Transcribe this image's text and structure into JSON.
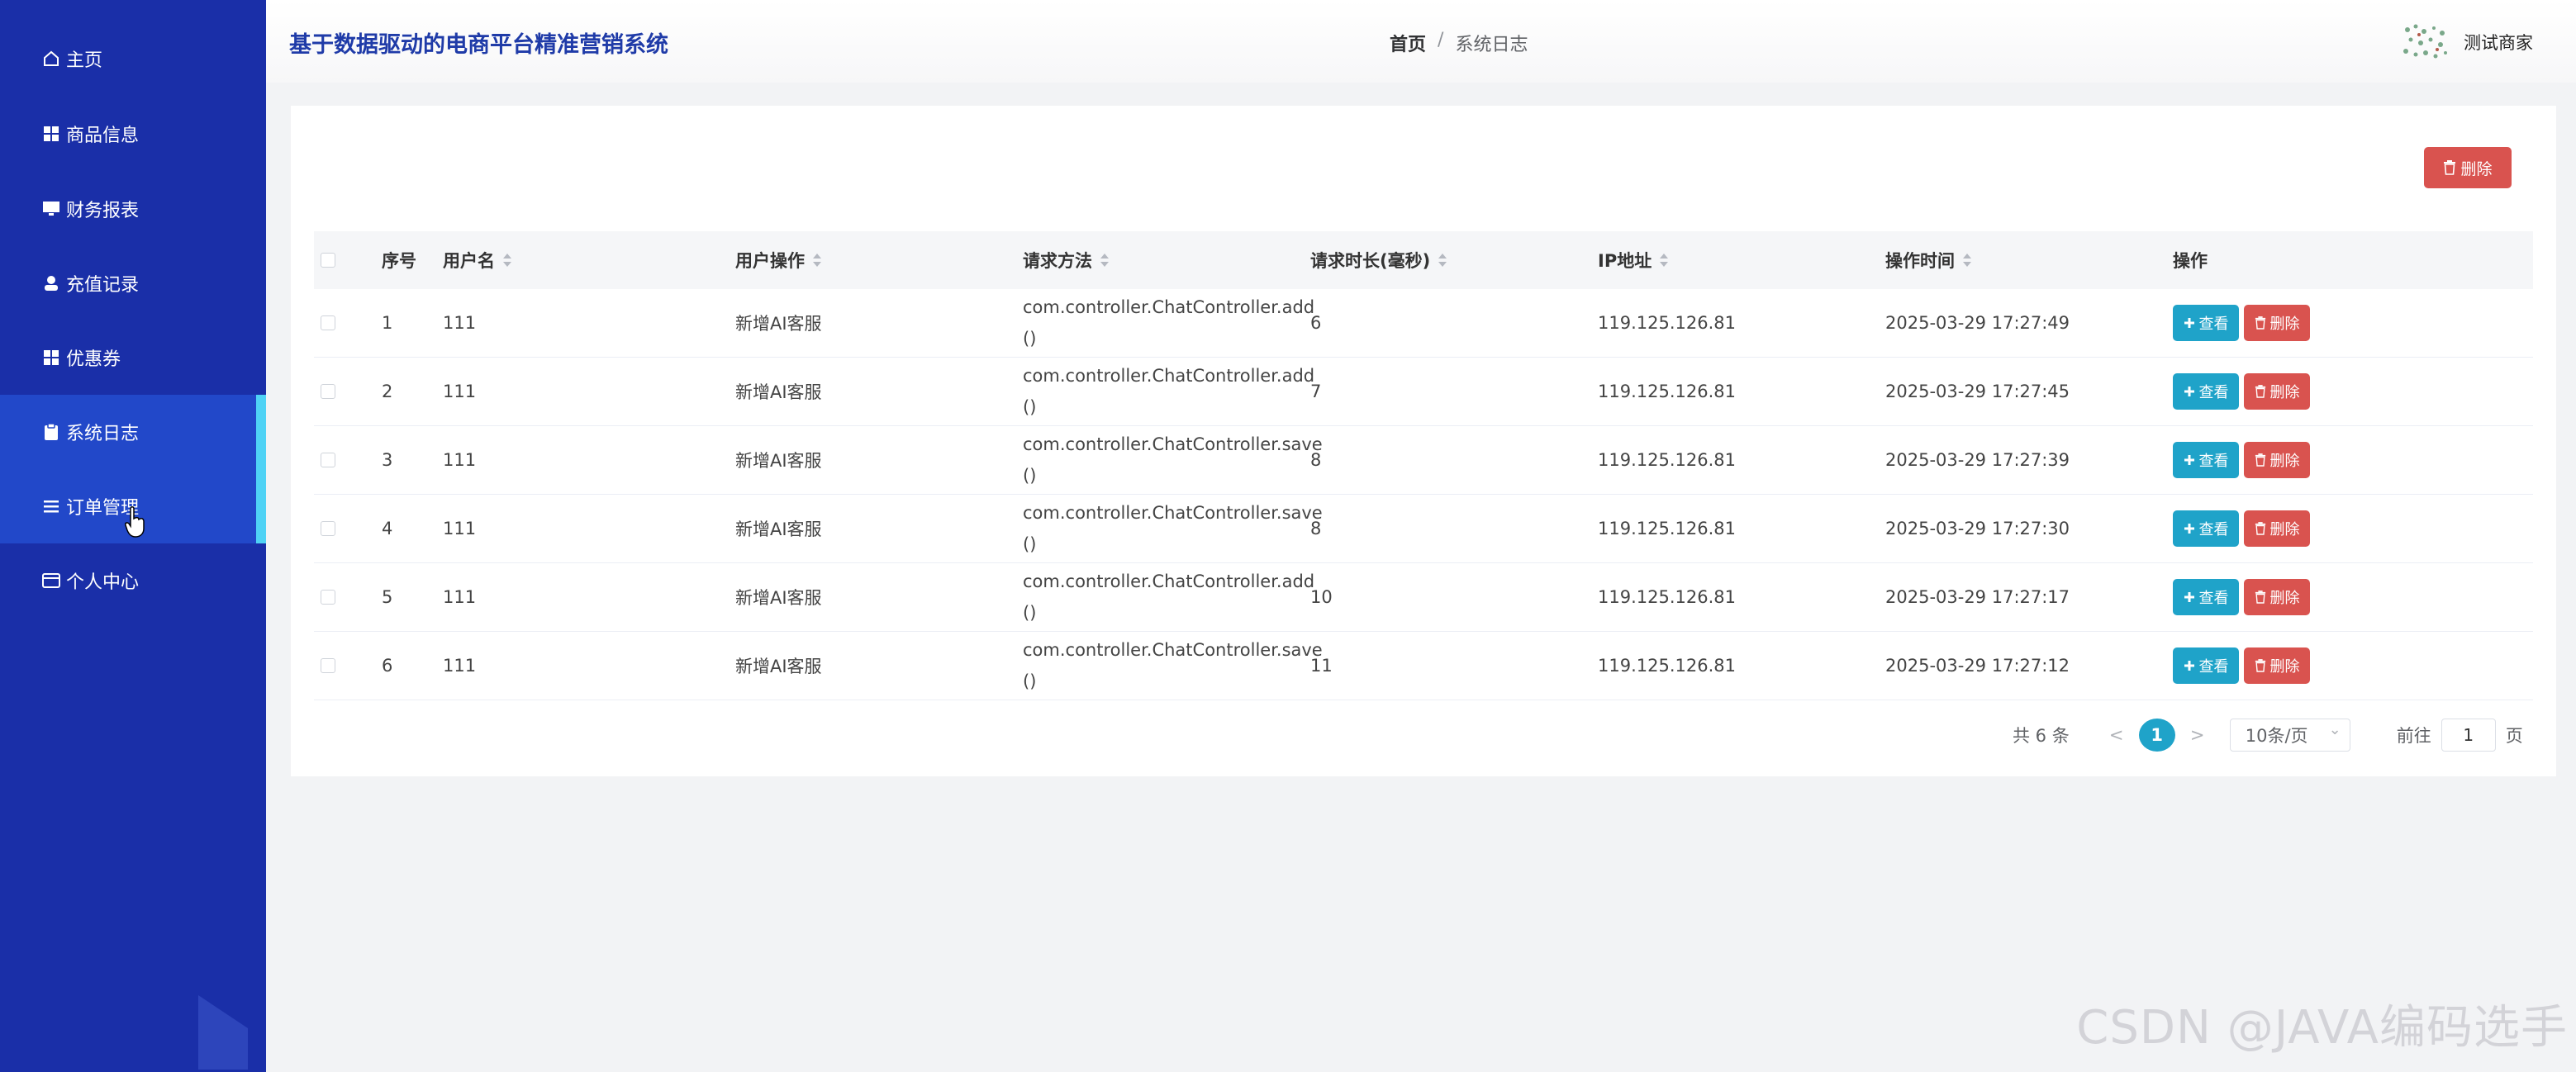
{
  "app_title": "基于数据驱动的电商平台精准营销系统",
  "breadcrumb": {
    "home": "首页",
    "separator": "/",
    "current": "系统日志"
  },
  "user": {
    "name": "测试商家"
  },
  "sidebar": {
    "items": [
      {
        "label": "主页",
        "icon": "home-icon"
      },
      {
        "label": "商品信息",
        "icon": "grid-icon"
      },
      {
        "label": "财务报表",
        "icon": "monitor-icon"
      },
      {
        "label": "充值记录",
        "icon": "user-icon"
      },
      {
        "label": "优惠券",
        "icon": "grid-icon"
      },
      {
        "label": "系统日志",
        "icon": "clipboard-icon"
      },
      {
        "label": "订单管理",
        "icon": "list-icon"
      },
      {
        "label": "个人中心",
        "icon": "card-icon"
      }
    ]
  },
  "toolbar": {
    "delete_label": "删除"
  },
  "table": {
    "columns": [
      "序号",
      "用户名",
      "用户操作",
      "请求方法",
      "请求时长(毫秒)",
      "IP地址",
      "操作时间",
      "操作"
    ],
    "rows": [
      {
        "index": "1",
        "username": "111",
        "operation": "新增AI客服",
        "method_line1": "com.controller.ChatController.add",
        "method_line2": "()",
        "duration": "6",
        "ip": "119.125.126.81",
        "time": "2025-03-29 17:27:49"
      },
      {
        "index": "2",
        "username": "111",
        "operation": "新增AI客服",
        "method_line1": "com.controller.ChatController.add",
        "method_line2": "()",
        "duration": "7",
        "ip": "119.125.126.81",
        "time": "2025-03-29 17:27:45"
      },
      {
        "index": "3",
        "username": "111",
        "operation": "新增AI客服",
        "method_line1": "com.controller.ChatController.save",
        "method_line2": "()",
        "duration": "8",
        "ip": "119.125.126.81",
        "time": "2025-03-29 17:27:39"
      },
      {
        "index": "4",
        "username": "111",
        "operation": "新增AI客服",
        "method_line1": "com.controller.ChatController.save",
        "method_line2": "()",
        "duration": "8",
        "ip": "119.125.126.81",
        "time": "2025-03-29 17:27:30"
      },
      {
        "index": "5",
        "username": "111",
        "operation": "新增AI客服",
        "method_line1": "com.controller.ChatController.add",
        "method_line2": "()",
        "duration": "10",
        "ip": "119.125.126.81",
        "time": "2025-03-29 17:27:17"
      },
      {
        "index": "6",
        "username": "111",
        "operation": "新增AI客服",
        "method_line1": "com.controller.ChatController.save",
        "method_line2": "()",
        "duration": "11",
        "ip": "119.125.126.81",
        "time": "2025-03-29 17:27:12"
      }
    ],
    "actions": {
      "view_label": "查看",
      "delete_label": "删除"
    }
  },
  "pagination": {
    "total_text": "共 6 条",
    "prev": "<",
    "current_page": "1",
    "next": ">",
    "page_size": "10条/页",
    "goto_prefix": "前往",
    "goto_value": "1",
    "goto_suffix": "页"
  },
  "watermark": "CSDN @JAVA编码选手",
  "colors": {
    "sidebar": "#1a2fa8",
    "active_item": "#2248c9",
    "accent": "#4fd2f5",
    "info": "#1fa3c9",
    "danger": "#d9534f"
  }
}
